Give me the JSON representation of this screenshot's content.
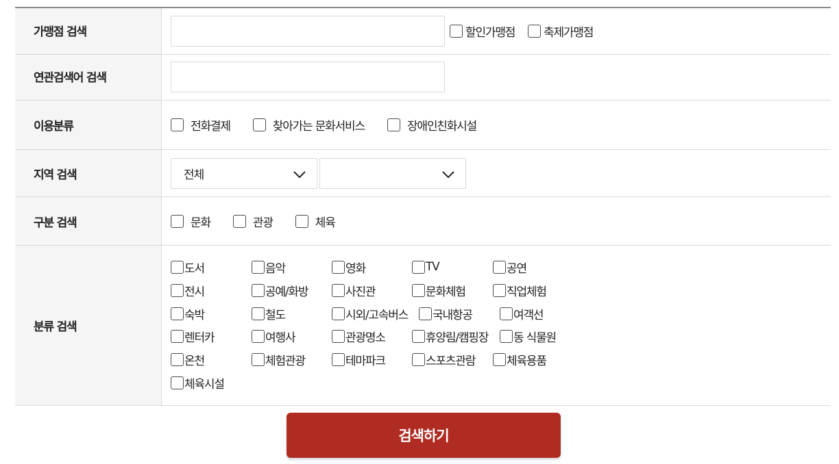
{
  "rows": {
    "affiliate_search": {
      "label": "가맹점 검색",
      "input_value": "",
      "options": [
        "할인가맹점",
        "축제가맹점"
      ]
    },
    "related_keyword_search": {
      "label": "연관검색어 검색",
      "input_value": ""
    },
    "usage_type": {
      "label": "이용분류",
      "options": [
        "전화결제",
        "찾아가는 문화서비스",
        "장애인친화시설"
      ]
    },
    "region_search": {
      "label": "지역 검색",
      "select1_value": "전체",
      "select2_value": ""
    },
    "division_search": {
      "label": "구분 검색",
      "options": [
        "문화",
        "관광",
        "체육"
      ]
    },
    "category_search": {
      "label": "분류 검색",
      "options": [
        "도서",
        "음악",
        "영화",
        "TV",
        "공연",
        "전시",
        "공예/화방",
        "사진관",
        "문화체험",
        "직업체험",
        "숙박",
        "철도",
        "시외/고속버스",
        "국내항공",
        "여객선",
        "렌터카",
        "여행사",
        "관광명소",
        "휴양림/캠핑장",
        "동 식물원",
        "온천",
        "체험관광",
        "테마파크",
        "스포츠관람",
        "체육용품",
        "체육시설"
      ]
    }
  },
  "search_button_label": "검색하기",
  "colors": {
    "button_bg": "#b02b22",
    "header_bg": "#f5f5f5",
    "border": "#d9d9d9"
  },
  "icons": {
    "checkbox": "checkbox-unchecked-icon",
    "select_arrow": "chevron-down-icon"
  }
}
